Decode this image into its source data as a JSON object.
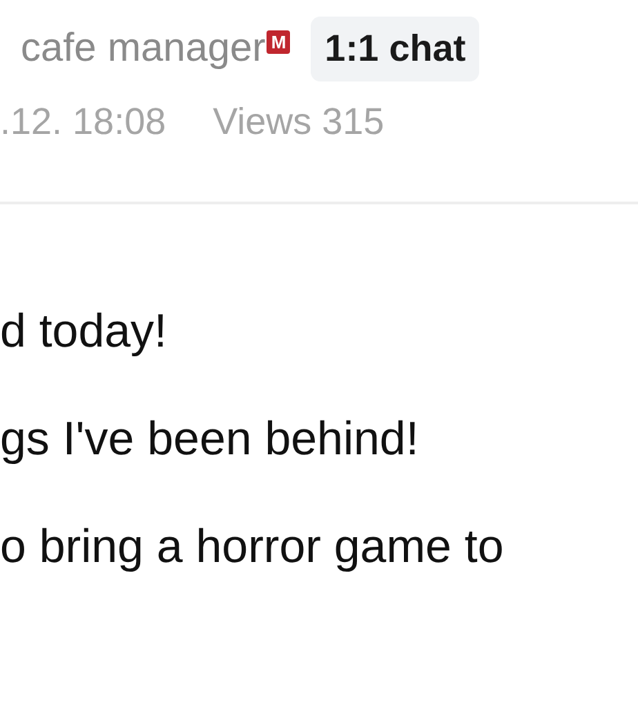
{
  "author": {
    "name": "cafe manager",
    "badge": "M",
    "chat_button": "1:1 chat"
  },
  "meta": {
    "date": ".12. 18:08",
    "views": "Views 315"
  },
  "body_lines": [
    "d today!",
    "gs I've been behind!",
    "o bring a horror game to"
  ]
}
